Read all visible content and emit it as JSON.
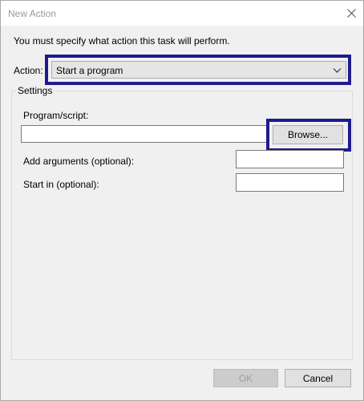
{
  "window": {
    "title": "New Action",
    "close_icon": "close-icon"
  },
  "instruction": "You must specify what action this task will perform.",
  "action": {
    "label": "Action:",
    "selected": "Start a program",
    "chevron_icon": "chevron-down-icon"
  },
  "settings": {
    "legend": "Settings",
    "program_label": "Program/script:",
    "program_value": "",
    "browse_label": "Browse...",
    "arguments_label": "Add arguments (optional):",
    "arguments_value": "",
    "start_in_label": "Start in (optional):",
    "start_in_value": ""
  },
  "buttons": {
    "ok_label": "OK",
    "cancel_label": "Cancel"
  },
  "colors": {
    "highlight": "#1e1b8e",
    "dialog_bg": "#f0f0f0"
  }
}
